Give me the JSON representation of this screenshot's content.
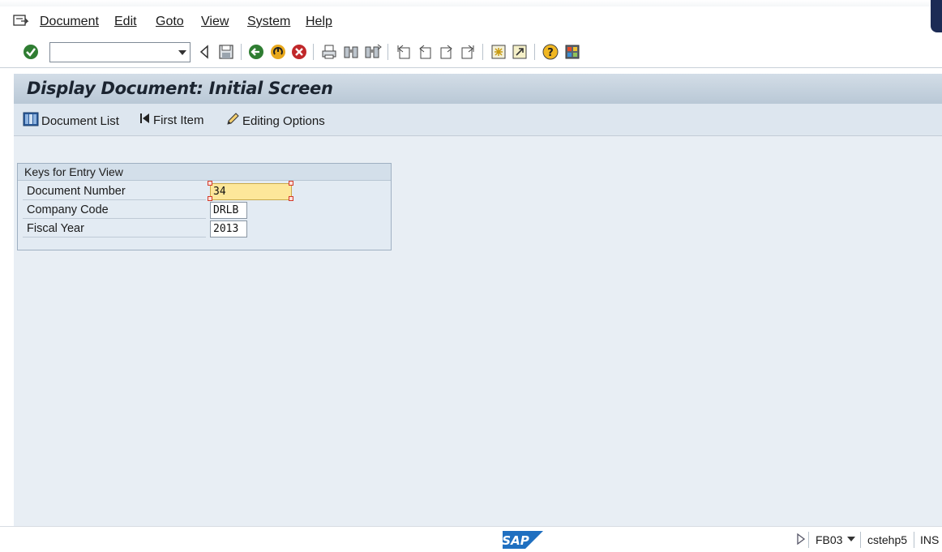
{
  "menu": {
    "items": [
      "Document",
      "Edit",
      "Goto",
      "View",
      "System",
      "Help"
    ]
  },
  "toolbar": {
    "command_field_value": "",
    "icons": [
      "enter-check-icon",
      "back-triangle-icon",
      "save-icon",
      "back-icon",
      "exit-icon",
      "cancel-icon",
      "print-icon",
      "find-icon",
      "find-next-icon",
      "first-page-icon",
      "previous-page-icon",
      "next-page-icon",
      "last-page-icon",
      "create-session-icon",
      "create-shortcut-icon",
      "help-icon",
      "customize-layout-icon"
    ]
  },
  "screen": {
    "title": "Display Document: Initial Screen",
    "app_toolbar": {
      "document_list": "Document List",
      "first_item": "First Item",
      "editing_options": "Editing Options"
    },
    "group": {
      "title": "Keys for Entry View",
      "rows": [
        {
          "label": "Document Number",
          "value": "34"
        },
        {
          "label": "Company Code",
          "value": "DRLB"
        },
        {
          "label": "Fiscal Year",
          "value": "2013"
        }
      ]
    }
  },
  "statusbar": {
    "logo_text": "SAP",
    "transaction": "FB03",
    "server": "cstehp5",
    "mode": "INS"
  },
  "colors": {
    "screen_bg": "#e8eef4",
    "active_field": "#fde79a",
    "sap_blue": "#1f6fc0"
  }
}
